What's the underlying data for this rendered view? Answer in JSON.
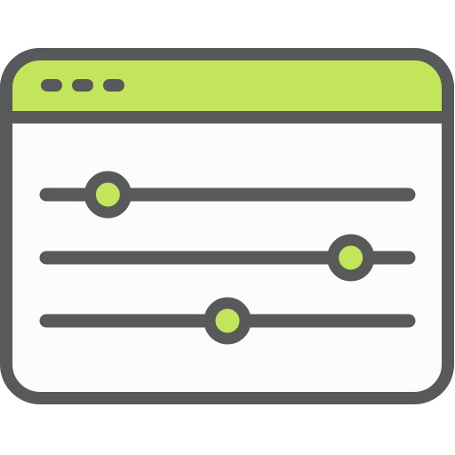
{
  "icon": "settings-window-sliders-icon",
  "colors": {
    "stroke": "#58595b",
    "accent": "#c2e55b",
    "fill": "#fcfcfc"
  },
  "titlebar": {
    "window_dots": 3
  },
  "sliders": [
    {
      "name": "slider-1",
      "level": 0.17
    },
    {
      "name": "slider-2",
      "level": 0.84
    },
    {
      "name": "slider-3",
      "level": 0.5
    }
  ]
}
